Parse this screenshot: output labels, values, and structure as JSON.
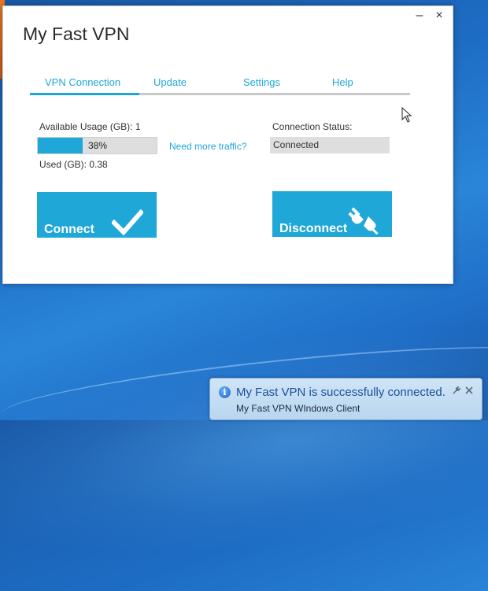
{
  "window": {
    "title": "My Fast VPN",
    "controls": {
      "minimize": "–",
      "close": "×"
    }
  },
  "tabs": [
    {
      "label": "VPN Connection",
      "active": true
    },
    {
      "label": "Update",
      "active": false
    },
    {
      "label": "Settings",
      "active": false
    },
    {
      "label": "Help",
      "active": false
    }
  ],
  "usage": {
    "available_label": "Available Usage (GB): 1",
    "progress_percent_text": "38%",
    "progress_fraction": 0.38,
    "used_label": "Used (GB): 0.38",
    "more_traffic_link": "Need more traffic?"
  },
  "status": {
    "label": "Connection Status:",
    "value": "Connected"
  },
  "buttons": {
    "connect": "Connect",
    "disconnect": "Disconnect"
  },
  "notification": {
    "title": "My Fast VPN is successfully connected.",
    "subtitle": "My Fast VPN WIndows Client",
    "info_glyph": "i"
  },
  "colors": {
    "accent": "#1ea7d7"
  },
  "icons": {
    "connect": "checkmark-icon",
    "disconnect": "unplug-icon"
  }
}
